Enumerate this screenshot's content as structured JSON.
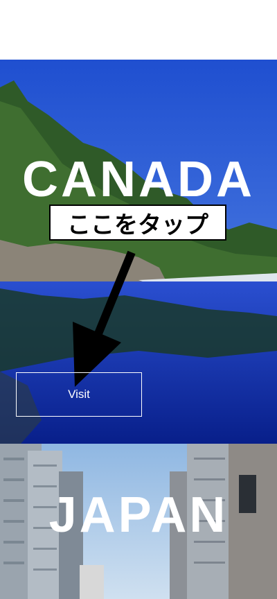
{
  "hero_canada": {
    "title": "CANADA",
    "annotation": "ここをタップ",
    "visit_label": "Visit"
  },
  "hero_japan": {
    "title": "JAPAN"
  },
  "colors": {
    "text": "#ffffff",
    "annotation_border": "#000000",
    "sky_canada": "#2f5fd6",
    "water": "#0c2a9a",
    "sky_japan": "#9fc3e6"
  },
  "icons": {
    "annotation_pointer": "arrow-down-left-icon"
  }
}
